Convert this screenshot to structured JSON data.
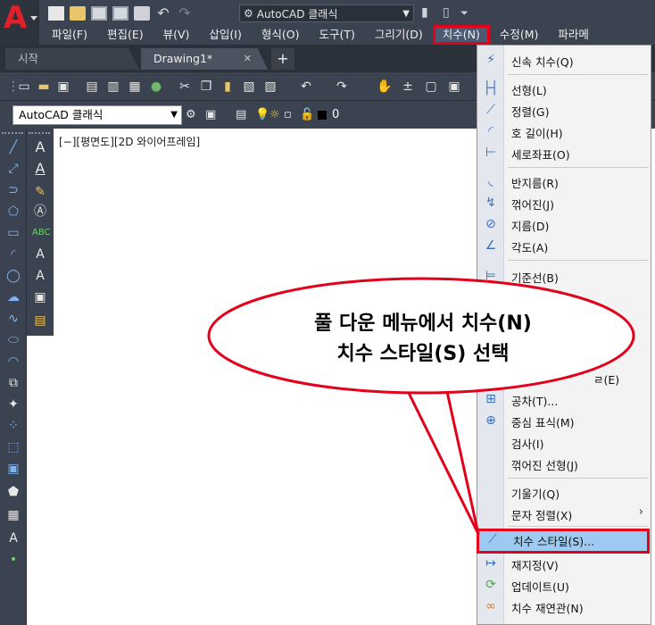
{
  "titlebar": {
    "workspace": "AutoCAD 클래식"
  },
  "menubar": {
    "items": [
      {
        "label": "파일(F)"
      },
      {
        "label": "편집(E)"
      },
      {
        "label": "뷰(V)"
      },
      {
        "label": "삽입(I)"
      },
      {
        "label": "형식(O)"
      },
      {
        "label": "도구(T)"
      },
      {
        "label": "그리기(D)"
      },
      {
        "label": "치수(N)"
      },
      {
        "label": "수정(M)"
      },
      {
        "label": "파라메"
      }
    ]
  },
  "tabs": [
    {
      "label": "시작"
    },
    {
      "label": "Drawing1*"
    },
    {
      "label": "+"
    }
  ],
  "toolbar2": {
    "workspace_combo": "AutoCAD 클래식",
    "layer_value": "0"
  },
  "viewport": {
    "label": "[−][평면도][2D 와이어프레임]"
  },
  "dimension_menu": {
    "items": [
      {
        "label": "신속 치수(Q)",
        "icon": "quick-dimension-icon"
      },
      {
        "label": "선형(L)",
        "icon": "linear-icon"
      },
      {
        "label": "정렬(G)",
        "icon": "aligned-icon"
      },
      {
        "label": "호 길이(H)",
        "icon": "arc-length-icon"
      },
      {
        "label": "세로좌표(O)",
        "icon": "ordinate-icon"
      },
      {
        "label": "반지름(R)",
        "icon": "radius-icon"
      },
      {
        "label": "꺾어진(J)",
        "icon": "jogged-icon"
      },
      {
        "label": "지름(D)",
        "icon": "diameter-icon"
      },
      {
        "label": "각도(A)",
        "icon": "angular-icon"
      },
      {
        "label": "기준선(B)",
        "icon": "baseline-icon"
      },
      {
        "label": "공차(T)...",
        "icon": "tolerance-icon"
      },
      {
        "label": "중심 표식(M)",
        "icon": "center-mark-icon"
      },
      {
        "label": "검사(I)",
        "icon": "inspection-icon"
      },
      {
        "label": "꺾어진 선형(J)",
        "icon": "jogged-linear-icon"
      },
      {
        "label": "기울기(Q)",
        "icon": "oblique-icon"
      },
      {
        "label": "문자 정렬(X)",
        "icon": "align-text-icon"
      },
      {
        "label": "치수 스타일(S)...",
        "icon": "dimension-style-icon"
      },
      {
        "label": "재지정(V)",
        "icon": "override-icon"
      },
      {
        "label": "업데이트(U)",
        "icon": "update-icon"
      },
      {
        "label": "치수 재연관(N)",
        "icon": "reassociate-icon"
      }
    ],
    "partial_label": "ㄹ(E)"
  },
  "callout": {
    "line1": "풀 다운 메뉴에서 치수(N)",
    "line2": "치수 스타일(S) 선택"
  },
  "colors": {
    "highlight_border": "#e3001b",
    "highlight_fill": "#9ec9f0",
    "ui_dark": "#3b4350"
  }
}
